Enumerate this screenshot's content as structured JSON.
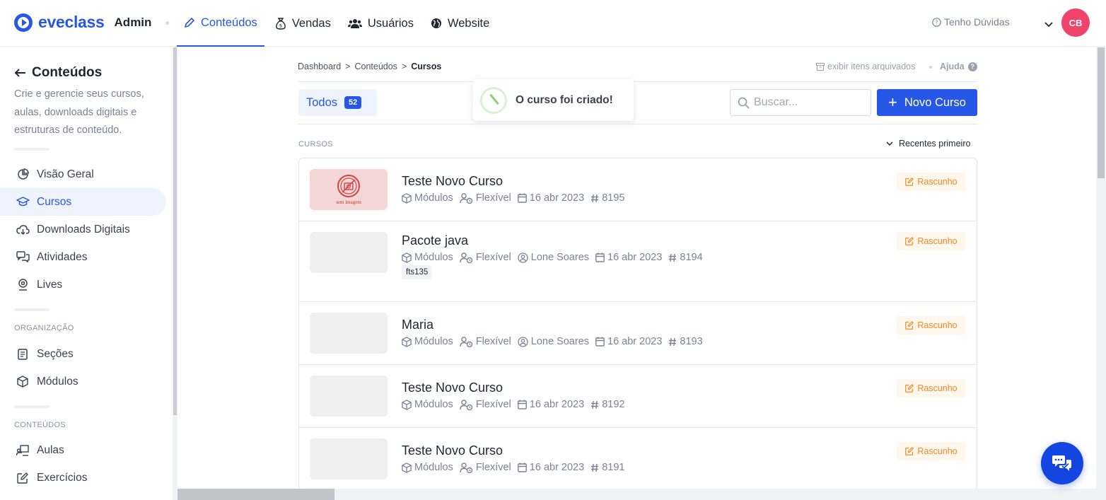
{
  "brand": {
    "name": "eveclass",
    "suffix": "Admin"
  },
  "nav": [
    {
      "label": "Conteúdos",
      "icon": "pencil-icon",
      "active": true
    },
    {
      "label": "Vendas",
      "icon": "money-bag-icon"
    },
    {
      "label": "Usuários",
      "icon": "users-icon"
    },
    {
      "label": "Website",
      "icon": "globe-icon"
    }
  ],
  "header": {
    "help_label": "Tenho Dúvidas",
    "avatar_initials": "CB",
    "avatar_color": "#f0436b"
  },
  "sidebar": {
    "title": "Conteúdos",
    "description": "Crie e gerencie seus cursos, aulas, downloads digitais e estruturas de conteúdo.",
    "items": [
      {
        "label": "Visão Geral",
        "icon": "pie-chart-icon"
      },
      {
        "label": "Cursos",
        "icon": "graduation-cap-icon",
        "active": true
      },
      {
        "label": "Downloads Digitais",
        "icon": "cloud-download-icon"
      },
      {
        "label": "Atividades",
        "icon": "chat-bubbles-icon"
      },
      {
        "label": "Lives",
        "icon": "webcam-icon"
      }
    ],
    "org_section": "ORGANIZAÇÃO",
    "org_items": [
      {
        "label": "Seções",
        "icon": "document-icon"
      },
      {
        "label": "Módulos",
        "icon": "cube-icon"
      }
    ],
    "content_section": "CONTEÚDOS",
    "content_items": [
      {
        "label": "Aulas",
        "icon": "teacher-board-icon"
      },
      {
        "label": "Exercícios",
        "icon": "edit-icon"
      }
    ]
  },
  "breadcrumb": [
    "Dashboard",
    "Conteúdos",
    "Cursos"
  ],
  "archived_label": "exibir itens arquivados",
  "help_small": "Ajuda",
  "tabs": {
    "all_label": "Todos",
    "all_count": "52"
  },
  "toast": {
    "message": "O curso foi criado!"
  },
  "search": {
    "placeholder": "Buscar...",
    "value": ""
  },
  "new_course_label": "Novo Curso",
  "list": {
    "section_label": "CURSOS",
    "sort_label": "Recentes primeiro",
    "no_image_caption": "sem imagem",
    "courses": [
      {
        "title": "Teste Novo Curso",
        "structure": "Módulos",
        "access": "Flexível",
        "author": "",
        "date": "16 abr 2023",
        "id": "8195",
        "status": "Rascunho",
        "tag": ""
      },
      {
        "title": "Pacote java",
        "structure": "Módulos",
        "access": "Flexível",
        "author": "Lone Soares",
        "date": "16 abr 2023",
        "id": "8194",
        "status": "Rascunho",
        "tag": "fts135"
      },
      {
        "title": "Maria",
        "structure": "Módulos",
        "access": "Flexível",
        "author": "Lone Soares",
        "date": "16 abr 2023",
        "id": "8193",
        "status": "Rascunho",
        "tag": ""
      },
      {
        "title": "Teste Novo Curso",
        "structure": "Módulos",
        "access": "Flexível",
        "author": "",
        "date": "16 abr 2023",
        "id": "8192",
        "status": "Rascunho",
        "tag": ""
      },
      {
        "title": "Teste Novo Curso",
        "structure": "Módulos",
        "access": "Flexível",
        "author": "",
        "date": "16 abr 2023",
        "id": "8191",
        "status": "Rascunho",
        "tag": ""
      }
    ]
  },
  "colors": {
    "primary": "#2657e6",
    "draft": "#f08a24",
    "draft_bg": "#fff6ec",
    "chat_fab": "#1346e0"
  }
}
